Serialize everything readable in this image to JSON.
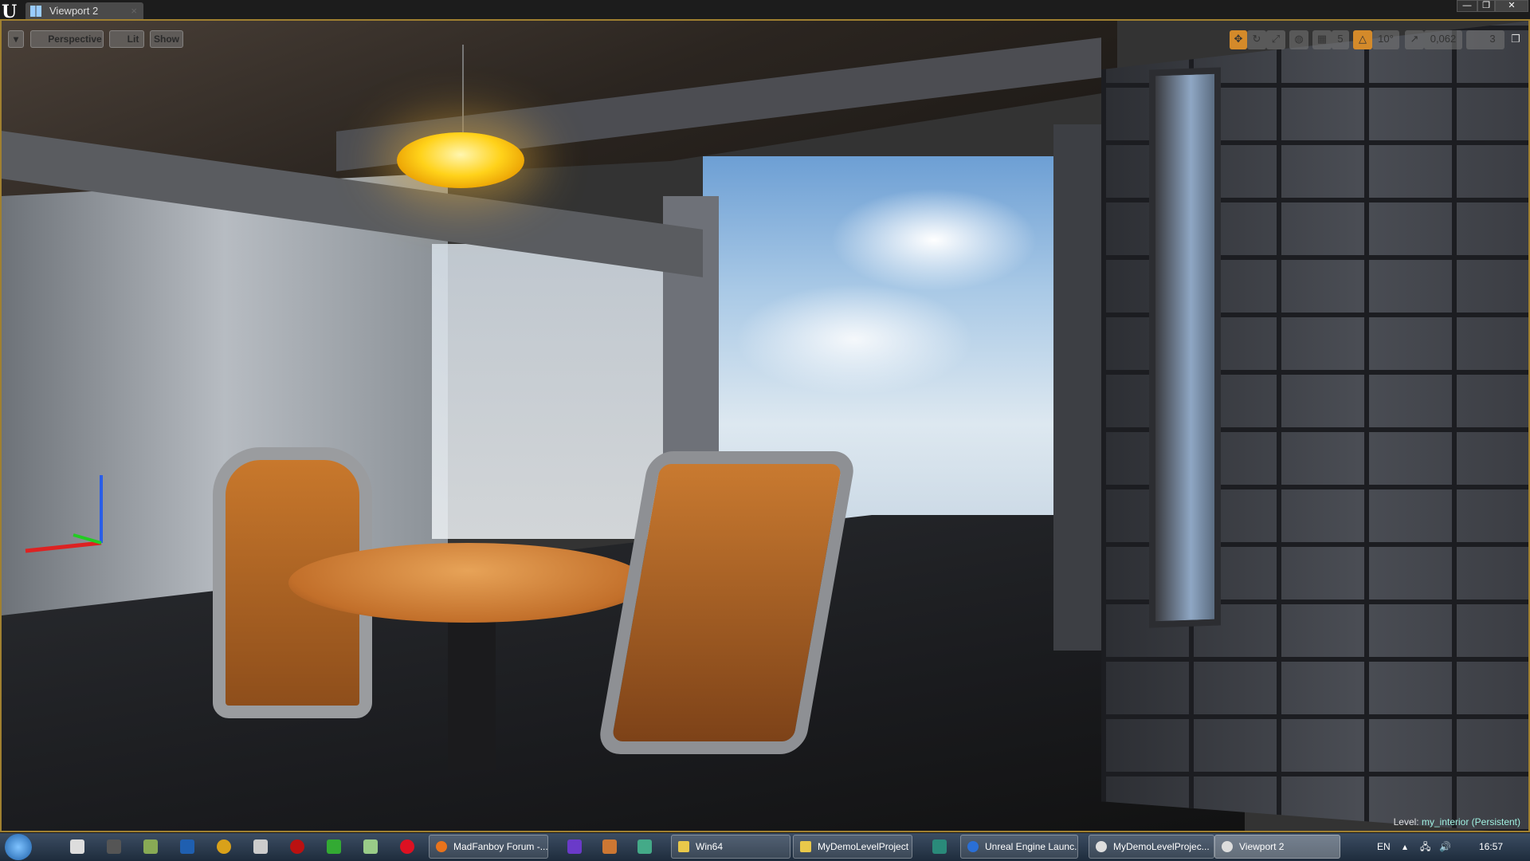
{
  "window": {
    "tab_title": "Viewport 2",
    "controls": [
      "—",
      "❐",
      "✕"
    ]
  },
  "viewport_toolbar": {
    "menu": "▾",
    "view_mode": "Perspective",
    "lighting": "Lit",
    "show": "Show"
  },
  "transform_toolbar": {
    "grid_snap": "5",
    "rotation_snap": "10°",
    "scale_snap": "0,062",
    "camera_speed": "3"
  },
  "level": {
    "label": "Level:",
    "value": "my_interior (Persistent)"
  },
  "taskbar": {
    "windows": [
      {
        "label": "MadFanboy Forum -...",
        "icon_color": "#e8731c"
      },
      {
        "label": "Win64",
        "icon_color": "#e9c84a"
      },
      {
        "label": "MyDemoLevelProject",
        "icon_color": "#e9c84a"
      },
      {
        "label": "Unreal Engine Launc...",
        "icon_color": "#2a6fd6"
      },
      {
        "label": "MyDemoLevelProjec...",
        "icon_color": "#222"
      },
      {
        "label": "Viewport 2",
        "icon_color": "#222"
      }
    ],
    "language": "EN",
    "clock": "16:57"
  },
  "colors": {
    "accent": "#d48a2a",
    "border": "#a08030"
  }
}
